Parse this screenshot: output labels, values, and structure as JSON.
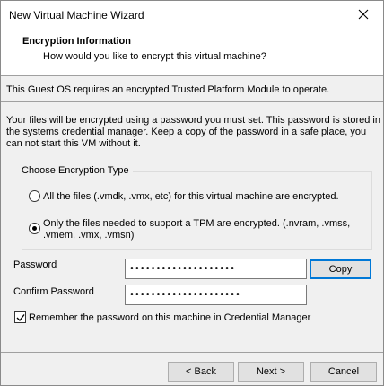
{
  "window": {
    "title": "New Virtual Machine Wizard"
  },
  "header": {
    "title": "Encryption Information",
    "subtitle": "How would you like to encrypt this virtual machine?"
  },
  "notice": "This Guest OS requires an encrypted Trusted Platform Module to operate.",
  "info": {
    "line1": "Your files will be encrypted using a password you must set. This password is stored in",
    "line2": "the systems credential manager. Keep a copy of the password in a safe place, you",
    "line3": "can not start this VM without it."
  },
  "encryption_type": {
    "legend": "Choose Encryption Type",
    "options": [
      {
        "line1": "All the files (.vmdk, .vmx, etc) for this virtual machine are encrypted.",
        "line2": "",
        "selected": false
      },
      {
        "line1": "Only the files needed to support a TPM are encrypted. (.nvram, .vmss,",
        "line2": ".vmem, .vmx, .vmsn)",
        "selected": true
      }
    ]
  },
  "password": {
    "label": "Password",
    "value": "••••••••••••••••••••",
    "copy_label": "Copy"
  },
  "confirm_password": {
    "label": "Confirm Password",
    "value": "•••••••••••••••••••••"
  },
  "remember": {
    "label": "Remember the password on this machine in Credential Manager",
    "checked": true
  },
  "buttons": {
    "back": "< Back",
    "next": "Next >",
    "cancel": "Cancel"
  },
  "icons": {
    "close": "close-icon",
    "check": "checkmark-icon"
  },
  "colors": {
    "default_button_border": "#0078d7",
    "window_bg": "#f0f0f0"
  }
}
